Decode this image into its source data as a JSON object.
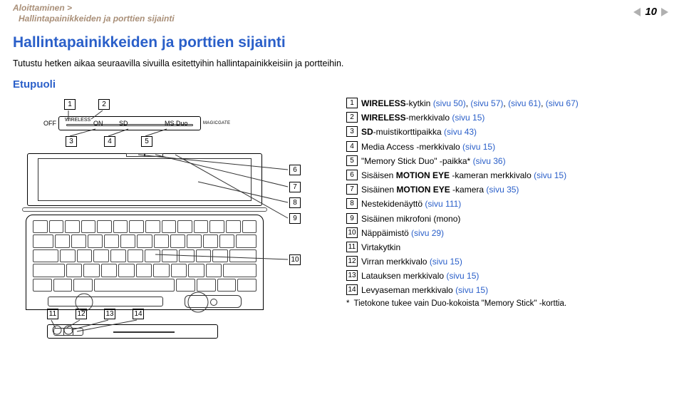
{
  "breadcrumb": {
    "line1": "Aloittaminen >",
    "line2": "Hallintapainikkeiden ja porttien sijainti"
  },
  "page_number": "10",
  "heading": "Hallintapainikkeiden ja porttien sijainti",
  "intro": "Tutustu hetken aikaa seuraavilla sivuilla esitettyihin hallintapainikkeisiin ja portteihin.",
  "subheading": "Etupuoli",
  "items": [
    {
      "num": "1",
      "parts": [
        {
          "text": "WIRELESS",
          "bold": true
        },
        {
          "text": "-kytkin "
        },
        {
          "text": "(sivu 50)",
          "link": true
        },
        {
          "text": ", "
        },
        {
          "text": "(sivu 57)",
          "link": true
        },
        {
          "text": ", "
        },
        {
          "text": "(sivu 61)",
          "link": true
        },
        {
          "text": ", "
        },
        {
          "text": "(sivu 67)",
          "link": true
        }
      ]
    },
    {
      "num": "2",
      "parts": [
        {
          "text": "WIRELESS",
          "bold": true
        },
        {
          "text": "-merkkivalo "
        },
        {
          "text": "(sivu 15)",
          "link": true
        }
      ]
    },
    {
      "num": "3",
      "parts": [
        {
          "text": "SD",
          "bold": true
        },
        {
          "text": "-muistikorttipaikka "
        },
        {
          "text": "(sivu 43)",
          "link": true
        }
      ]
    },
    {
      "num": "4",
      "parts": [
        {
          "text": "Media Access -merkkivalo "
        },
        {
          "text": "(sivu 15)",
          "link": true
        }
      ]
    },
    {
      "num": "5",
      "parts": [
        {
          "text": "\"Memory Stick Duo\" -paikka* "
        },
        {
          "text": "(sivu 36)",
          "link": true
        }
      ]
    },
    {
      "num": "6",
      "parts": [
        {
          "text": "Sisäisen "
        },
        {
          "text": "MOTION EYE",
          "bold": true
        },
        {
          "text": " -kameran merkkivalo "
        },
        {
          "text": "(sivu 15)",
          "link": true
        }
      ]
    },
    {
      "num": "7",
      "parts": [
        {
          "text": "Sisäinen "
        },
        {
          "text": "MOTION EYE",
          "bold": true
        },
        {
          "text": " -kamera "
        },
        {
          "text": "(sivu 35)",
          "link": true
        }
      ]
    },
    {
      "num": "8",
      "parts": [
        {
          "text": "Nestekidenäyttö "
        },
        {
          "text": "(sivu 111)",
          "link": true
        }
      ]
    },
    {
      "num": "9",
      "parts": [
        {
          "text": "Sisäinen mikrofoni (mono)"
        }
      ]
    },
    {
      "num": "10",
      "parts": [
        {
          "text": "Näppäimistö "
        },
        {
          "text": "(sivu 29)",
          "link": true
        }
      ]
    },
    {
      "num": "11",
      "parts": [
        {
          "text": "Virtakytkin"
        }
      ]
    },
    {
      "num": "12",
      "parts": [
        {
          "text": "Virran merkkivalo "
        },
        {
          "text": "(sivu 15)",
          "link": true
        }
      ]
    },
    {
      "num": "13",
      "parts": [
        {
          "text": "Latauksen merkkivalo "
        },
        {
          "text": "(sivu 15)",
          "link": true
        }
      ]
    },
    {
      "num": "14",
      "parts": [
        {
          "text": "Levyaseman merkkivalo "
        },
        {
          "text": "(sivu 15)",
          "link": true
        }
      ]
    }
  ],
  "footnote": {
    "marker": "*",
    "text": "Tietokone tukee vain Duo-kokoista \"Memory Stick\" -korttia."
  },
  "diagram": {
    "callout_numbers_top": [
      "1",
      "2"
    ],
    "callout_numbers_mid": [
      "3",
      "4",
      "5"
    ],
    "callout_numbers_right": [
      "6",
      "7",
      "8",
      "9",
      "10"
    ],
    "callout_numbers_bottom": [
      "11",
      "12",
      "13",
      "14"
    ],
    "labels": {
      "off": "OFF",
      "on": "ON",
      "wireless": "WIRELESS",
      "sd": "SD",
      "msduo": "MS Duo",
      "magicgate": "MAGICGATE"
    }
  }
}
